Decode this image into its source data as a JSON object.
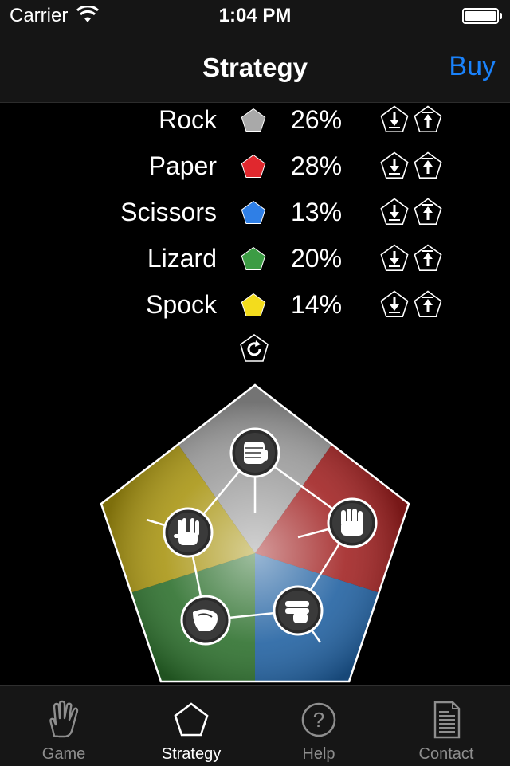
{
  "status_bar": {
    "carrier": "Carrier",
    "time": "1:04 PM"
  },
  "nav": {
    "title": "Strategy",
    "buy_label": "Buy"
  },
  "strategy": {
    "items": [
      {
        "name": "Rock",
        "percent": "26%",
        "color": "#a9a9a9"
      },
      {
        "name": "Paper",
        "percent": "28%",
        "color": "#e0282e"
      },
      {
        "name": "Scissors",
        "percent": "13%",
        "color": "#2f7fe6"
      },
      {
        "name": "Lizard",
        "percent": "20%",
        "color": "#3c9c44"
      },
      {
        "name": "Spock",
        "percent": "14%",
        "color": "#f3dc1d"
      }
    ],
    "decrease_icon": "arrow-down-pentagon-icon",
    "increase_icon": "arrow-up-pentagon-icon",
    "reset_icon": "refresh-pentagon-icon"
  },
  "diagram": {
    "segments": [
      {
        "name": "Rock",
        "color": "#9a9a9a",
        "hand_icon": "rock-fist-icon"
      },
      {
        "name": "Paper",
        "color": "#a02020",
        "hand_icon": "paper-hand-icon"
      },
      {
        "name": "Scissors",
        "color": "#1e5fa0",
        "hand_icon": "scissors-hand-icon"
      },
      {
        "name": "Lizard",
        "color": "#2a6e2a",
        "hand_icon": "lizard-hand-icon"
      },
      {
        "name": "Spock",
        "color": "#a89410",
        "hand_icon": "spock-hand-icon"
      }
    ]
  },
  "tab_bar": {
    "tabs": [
      {
        "label": "Game",
        "icon": "spock-hand-icon",
        "active": false
      },
      {
        "label": "Strategy",
        "icon": "pentagon-icon",
        "active": true
      },
      {
        "label": "Help",
        "icon": "question-circle-icon",
        "active": false
      },
      {
        "label": "Contact",
        "icon": "document-icon",
        "active": false
      }
    ]
  }
}
